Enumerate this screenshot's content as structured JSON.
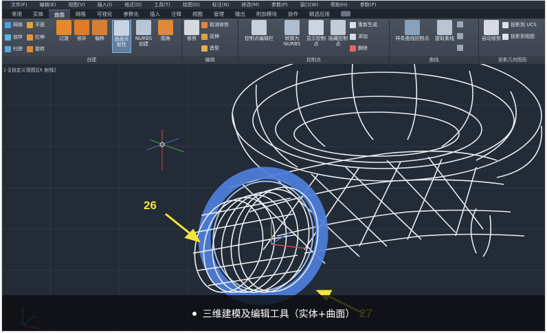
{
  "menu": {
    "items": [
      "文件(F)",
      "编辑(E)",
      "视图(V)",
      "插入(I)",
      "格式(O)",
      "工具(T)",
      "绘图(D)",
      "标注(N)",
      "修改(M)",
      "参数(P)",
      "窗口(W)",
      "帮助(H)",
      "参数(P)"
    ]
  },
  "tabs": {
    "items": [
      "常用",
      "实体",
      "曲面",
      "网格",
      "可视化",
      "参数化",
      "插入",
      "注释",
      "视图",
      "管理",
      "输出",
      "附加模块",
      "协作",
      "精选应用"
    ],
    "active_index": 2
  },
  "ribbon": {
    "panel_create": "创建",
    "panel_edit": "编辑",
    "panel_controlpoints": "控制点",
    "panel_curves": "曲线",
    "panel_projection": "投影几何图形",
    "btn_network": "网络",
    "btn_planar": "平面",
    "btn_loft": "放样",
    "btn_extrude": "拉伸",
    "btn_sweep": "扫掠",
    "btn_revolve": "旋转",
    "btn_blend": "过渡",
    "btn_patch": "修补",
    "btn_offset": "偏移",
    "btn_surface_assoc": "曲面关联性",
    "btn_nurbs_create": "NURBS创建",
    "btn_fillet": "圆角",
    "btn_trim": "修剪",
    "btn_untrim": "取消修剪",
    "btn_extend": "延伸",
    "btn_sculpt": "造型",
    "btn_cv_edit_bar": "控制点编辑栏",
    "btn_convert_nurbs": "转换为NURBS",
    "btn_show_cv": "显示控制点",
    "btn_hide_cv": "隐藏控制点",
    "btn_rebuild": "重新生成",
    "btn_add": "添加",
    "btn_remove": "删除",
    "btn_spline_cv": "样条曲线控制点",
    "btn_extract_iso": "提取素线",
    "btn_auto_trim": "自动修剪",
    "btn_project_ucs": "投影到 UCS",
    "btn_project_view": "投影到视图"
  },
  "viewport": {
    "label": "[-][自定义视图][X 射线]"
  },
  "callouts": {
    "left": "26",
    "right": "27"
  },
  "caption": {
    "text": "三维建模及编辑工具（实体+曲面）"
  },
  "colors": {
    "viewport_bg": "#232b36",
    "wire": "#e8ecef",
    "ring_blue": "#4f7fdc",
    "callout_yellow": "#f2e43c"
  }
}
